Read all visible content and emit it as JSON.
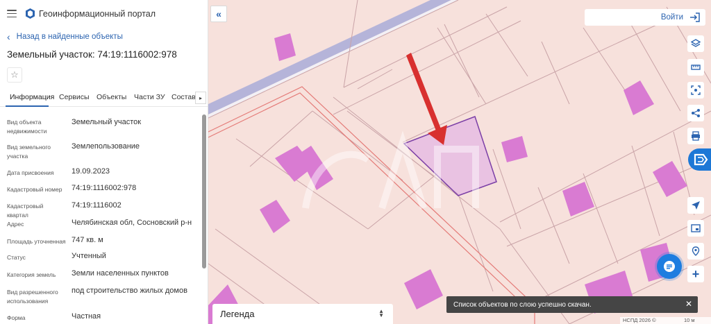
{
  "header": {
    "portal_title": "Геоинформационный портал"
  },
  "object": {
    "back_link": "Назад в найденные объекты",
    "title": "Земельный участок: 74:19:1116002:978"
  },
  "tabs": [
    "Информация",
    "Сервисы",
    "Объекты",
    "Части ЗУ",
    "Состав"
  ],
  "attributes": [
    {
      "label": "Вид объекта недвижимости",
      "value": "Земельный участок"
    },
    {
      "label": "Вид земельного участка",
      "value": "Землепользование"
    },
    {
      "label": "Дата присвоения",
      "value": "19.09.2023"
    },
    {
      "label": "Кадастровый номер",
      "value": "74:19:1116002:978"
    },
    {
      "label": "Кадастровый квартал",
      "value": "74:19:1116002"
    },
    {
      "label": "Адрес",
      "value": "Челябинская обл, Сосновский р-н"
    },
    {
      "label": "Площадь уточненная",
      "value": "747 кв. м"
    },
    {
      "label": "Статус",
      "value": "Учтенный"
    },
    {
      "label": "Категория земель",
      "value": "Земли населенных пунктов"
    },
    {
      "label": "Вид разрешенного использования",
      "value": "под строительство жилых домов"
    },
    {
      "label": "Форма собственности",
      "value": "Частная"
    }
  ],
  "map": {
    "login_label": "Войти",
    "legend_label": "Легенда",
    "toast_text": "Список объектов по слою успешно скачан.",
    "scale_text": "НСПД 2026 ©",
    "scale_value": "10 м",
    "colors": {
      "background": "#f7e1dc",
      "parcel_line": "#c9a3a7",
      "building_fill": "#d97bd2",
      "selected_outline": "#7b3fa6",
      "road": "#a9acd8",
      "arrow": "#d8302f",
      "accent": "#2c64b0"
    }
  }
}
